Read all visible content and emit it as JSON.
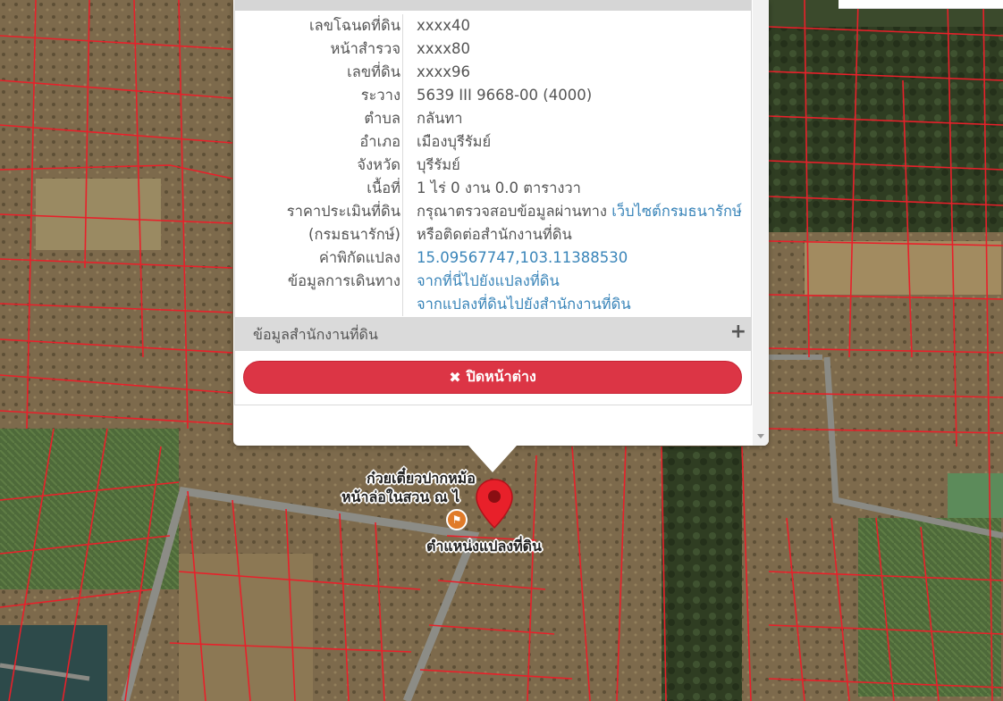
{
  "popup": {
    "rows": [
      {
        "label": "เลขโฉนดที่ดิน",
        "value": "xxxx40"
      },
      {
        "label": "หน้าสำรวจ",
        "value": "xxxx80"
      },
      {
        "label": "เลขที่ดิน",
        "value": "xxxx96"
      },
      {
        "label": "ระวาง",
        "value": "5639 III 9668-00 (4000)"
      },
      {
        "label": "ตำบล",
        "value": "กลันทา"
      },
      {
        "label": "อำเภอ",
        "value": "เมืองบุรีรัมย์"
      },
      {
        "label": "จังหวัด",
        "value": "บุรีรัมย์"
      },
      {
        "label": "เนื้อที่",
        "value": "1 ไร่ 0 งาน 0.0 ตารางวา"
      },
      {
        "label": "ราคาประเมินที่ดิน",
        "value": "กรุณาตรวจสอบข้อมูลผ่านทาง",
        "link": "เว็บไซต์กรมธนารักษ์"
      },
      {
        "label": "(กรมธนารักษ์)",
        "value": "หรือติดต่อสำนักงานที่ดิน"
      },
      {
        "label": "ค่าพิกัดแปลง",
        "link": "15.09567747,103.11388530"
      },
      {
        "label": "ข้อมูลการเดินทาง",
        "link": "จากที่นี่ไปยังแปลงที่ดิน"
      },
      {
        "label": "",
        "link": "จากแปลงที่ดินไปยังสำนักงานที่ดิน"
      }
    ],
    "office_section": {
      "label": "ข้อมูลสำนักงานที่ดิน",
      "toggle": "+"
    },
    "close_button": {
      "icon": "✖",
      "label": "ปิดหน้าต่าง"
    }
  },
  "map": {
    "poi_label_line1": "ก๋วยเตี๋ยวปากหม้อ",
    "poi_label_line2": "หน้าล่อในสวน ณ ไ",
    "marker_label": "ตำแหน่งแปลงที่ดิน",
    "colors": {
      "parcel_line": "#e8202a",
      "marker": "#e8202a",
      "poi": "#e07b2a"
    }
  }
}
